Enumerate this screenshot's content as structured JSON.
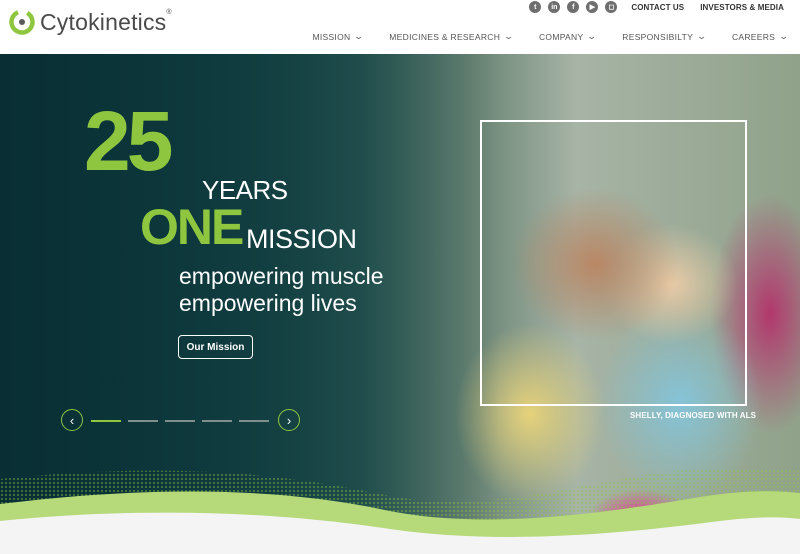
{
  "brand": {
    "name": "Cytokinetics",
    "tm": "®"
  },
  "social_icons": [
    "twitter-icon",
    "linkedin-icon",
    "facebook-icon",
    "youtube-icon",
    "instagram-icon"
  ],
  "top_links": [
    "CONTACT US",
    "INVESTORS & MEDIA"
  ],
  "nav": [
    {
      "label": "MISSION"
    },
    {
      "label": "MEDICINES & RESEARCH"
    },
    {
      "label": "COMPANY"
    },
    {
      "label": "RESPONSIBILTY"
    },
    {
      "label": "CAREERS"
    }
  ],
  "hero": {
    "number": "25",
    "years": "YEARS",
    "one": "ONE",
    "mission": "MISSION",
    "tagline_line1": "empowering muscle",
    "tagline_line2": "empowering lives",
    "cta_label": "Our Mission",
    "caption": "SHELLY, DIAGNOSED WITH ALS",
    "slides_total": 5,
    "active_slide": 1
  },
  "colors": {
    "accent": "#8ec63f",
    "dark_teal": "#0d3a40",
    "text_gray": "#4a4a4a"
  }
}
